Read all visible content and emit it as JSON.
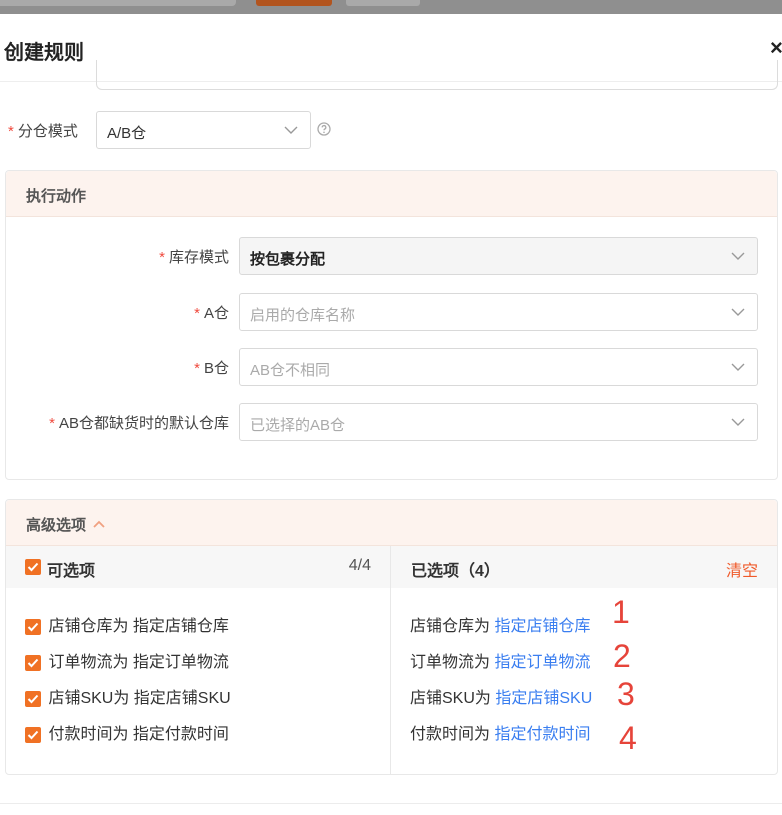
{
  "dialog": {
    "title": "创建规则",
    "close_glyph": "×"
  },
  "split_mode": {
    "label": "分仓模式",
    "value": "A/B仓"
  },
  "action_panel": {
    "title": "执行动作",
    "fields": [
      {
        "label": "库存模式",
        "value": "按包裹分配",
        "placeholder": ""
      },
      {
        "label": "A仓",
        "value": "",
        "placeholder": "启用的仓库名称"
      },
      {
        "label": "B仓",
        "value": "",
        "placeholder": "AB仓不相同"
      },
      {
        "label": "AB仓都缺货时的默认仓库",
        "value": "",
        "placeholder": "已选择的AB仓"
      }
    ]
  },
  "advanced_panel": {
    "title": "高级选项",
    "left": {
      "header": "可选项",
      "count": "4/4",
      "items": [
        "店铺仓库为 指定店铺仓库",
        "订单物流为 指定订单物流",
        "店铺SKU为 指定店铺SKU",
        "付款时间为 指定付款时间"
      ]
    },
    "right": {
      "header": "已选项（4）",
      "clear": "清空",
      "items": [
        {
          "prefix": "店铺仓库为",
          "link": "指定店铺仓库"
        },
        {
          "prefix": "订单物流为",
          "link": "指定订单物流"
        },
        {
          "prefix": "店铺SKU为",
          "link": "指定店铺SKU"
        },
        {
          "prefix": "付款时间为",
          "link": "指定付款时间"
        }
      ]
    }
  },
  "annotations": [
    "1",
    "2",
    "3",
    "4"
  ],
  "colors": {
    "accent": "#f07124",
    "link": "#3a7ef0",
    "required": "#f04a3e",
    "annotation": "#e6443a"
  }
}
